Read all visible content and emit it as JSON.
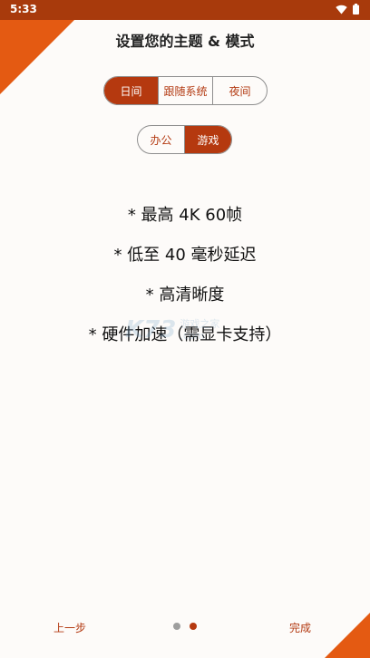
{
  "status_bar": {
    "time": "5:33",
    "icons": [
      "wifi-icon",
      "battery-icon"
    ]
  },
  "title": "设置您的主题 & 模式",
  "theme_options": {
    "items": [
      "日间",
      "跟随系统",
      "夜间"
    ],
    "selected": "日间"
  },
  "mode_options": {
    "items": [
      "办公",
      "游戏"
    ],
    "selected": "游戏"
  },
  "features": [
    "* 最高 4K 60帧",
    "* 低至 40 毫秒延迟",
    "* 高清晰度",
    "* 硬件加速（需显卡支持）"
  ],
  "watermark": {
    "logo": "K73",
    "line1": "游戏之家",
    "line2": ".com"
  },
  "navigation": {
    "prev_label": "上一步",
    "done_label": "完成",
    "page_count": 2,
    "current_page": 2
  },
  "colors": {
    "accent": "#b5390f",
    "accent_light": "#e45a12",
    "status_bar": "#a83a0c",
    "background": "#fdfbf9"
  }
}
